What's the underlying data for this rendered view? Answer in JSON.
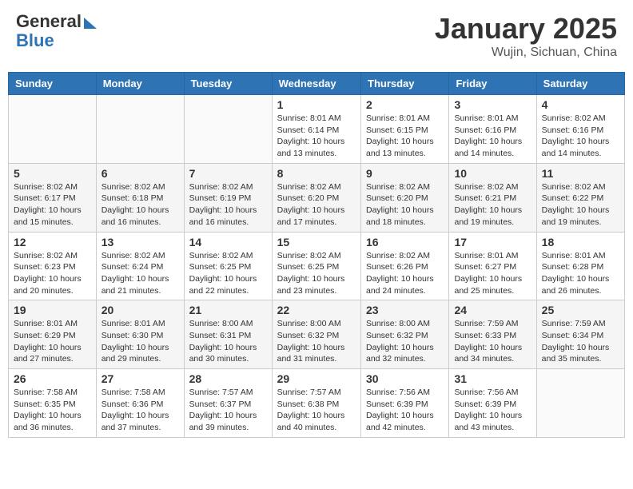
{
  "header": {
    "logo_general": "General",
    "logo_blue": "Blue",
    "month_title": "January 2025",
    "location": "Wujin, Sichuan, China"
  },
  "weekdays": [
    "Sunday",
    "Monday",
    "Tuesday",
    "Wednesday",
    "Thursday",
    "Friday",
    "Saturday"
  ],
  "weeks": [
    [
      {
        "day": "",
        "detail": ""
      },
      {
        "day": "",
        "detail": ""
      },
      {
        "day": "",
        "detail": ""
      },
      {
        "day": "1",
        "detail": "Sunrise: 8:01 AM\nSunset: 6:14 PM\nDaylight: 10 hours\nand 13 minutes."
      },
      {
        "day": "2",
        "detail": "Sunrise: 8:01 AM\nSunset: 6:15 PM\nDaylight: 10 hours\nand 13 minutes."
      },
      {
        "day": "3",
        "detail": "Sunrise: 8:01 AM\nSunset: 6:16 PM\nDaylight: 10 hours\nand 14 minutes."
      },
      {
        "day": "4",
        "detail": "Sunrise: 8:02 AM\nSunset: 6:16 PM\nDaylight: 10 hours\nand 14 minutes."
      }
    ],
    [
      {
        "day": "5",
        "detail": "Sunrise: 8:02 AM\nSunset: 6:17 PM\nDaylight: 10 hours\nand 15 minutes."
      },
      {
        "day": "6",
        "detail": "Sunrise: 8:02 AM\nSunset: 6:18 PM\nDaylight: 10 hours\nand 16 minutes."
      },
      {
        "day": "7",
        "detail": "Sunrise: 8:02 AM\nSunset: 6:19 PM\nDaylight: 10 hours\nand 16 minutes."
      },
      {
        "day": "8",
        "detail": "Sunrise: 8:02 AM\nSunset: 6:20 PM\nDaylight: 10 hours\nand 17 minutes."
      },
      {
        "day": "9",
        "detail": "Sunrise: 8:02 AM\nSunset: 6:20 PM\nDaylight: 10 hours\nand 18 minutes."
      },
      {
        "day": "10",
        "detail": "Sunrise: 8:02 AM\nSunset: 6:21 PM\nDaylight: 10 hours\nand 19 minutes."
      },
      {
        "day": "11",
        "detail": "Sunrise: 8:02 AM\nSunset: 6:22 PM\nDaylight: 10 hours\nand 19 minutes."
      }
    ],
    [
      {
        "day": "12",
        "detail": "Sunrise: 8:02 AM\nSunset: 6:23 PM\nDaylight: 10 hours\nand 20 minutes."
      },
      {
        "day": "13",
        "detail": "Sunrise: 8:02 AM\nSunset: 6:24 PM\nDaylight: 10 hours\nand 21 minutes."
      },
      {
        "day": "14",
        "detail": "Sunrise: 8:02 AM\nSunset: 6:25 PM\nDaylight: 10 hours\nand 22 minutes."
      },
      {
        "day": "15",
        "detail": "Sunrise: 8:02 AM\nSunset: 6:25 PM\nDaylight: 10 hours\nand 23 minutes."
      },
      {
        "day": "16",
        "detail": "Sunrise: 8:02 AM\nSunset: 6:26 PM\nDaylight: 10 hours\nand 24 minutes."
      },
      {
        "day": "17",
        "detail": "Sunrise: 8:01 AM\nSunset: 6:27 PM\nDaylight: 10 hours\nand 25 minutes."
      },
      {
        "day": "18",
        "detail": "Sunrise: 8:01 AM\nSunset: 6:28 PM\nDaylight: 10 hours\nand 26 minutes."
      }
    ],
    [
      {
        "day": "19",
        "detail": "Sunrise: 8:01 AM\nSunset: 6:29 PM\nDaylight: 10 hours\nand 27 minutes."
      },
      {
        "day": "20",
        "detail": "Sunrise: 8:01 AM\nSunset: 6:30 PM\nDaylight: 10 hours\nand 29 minutes."
      },
      {
        "day": "21",
        "detail": "Sunrise: 8:00 AM\nSunset: 6:31 PM\nDaylight: 10 hours\nand 30 minutes."
      },
      {
        "day": "22",
        "detail": "Sunrise: 8:00 AM\nSunset: 6:32 PM\nDaylight: 10 hours\nand 31 minutes."
      },
      {
        "day": "23",
        "detail": "Sunrise: 8:00 AM\nSunset: 6:32 PM\nDaylight: 10 hours\nand 32 minutes."
      },
      {
        "day": "24",
        "detail": "Sunrise: 7:59 AM\nSunset: 6:33 PM\nDaylight: 10 hours\nand 34 minutes."
      },
      {
        "day": "25",
        "detail": "Sunrise: 7:59 AM\nSunset: 6:34 PM\nDaylight: 10 hours\nand 35 minutes."
      }
    ],
    [
      {
        "day": "26",
        "detail": "Sunrise: 7:58 AM\nSunset: 6:35 PM\nDaylight: 10 hours\nand 36 minutes."
      },
      {
        "day": "27",
        "detail": "Sunrise: 7:58 AM\nSunset: 6:36 PM\nDaylight: 10 hours\nand 37 minutes."
      },
      {
        "day": "28",
        "detail": "Sunrise: 7:57 AM\nSunset: 6:37 PM\nDaylight: 10 hours\nand 39 minutes."
      },
      {
        "day": "29",
        "detail": "Sunrise: 7:57 AM\nSunset: 6:38 PM\nDaylight: 10 hours\nand 40 minutes."
      },
      {
        "day": "30",
        "detail": "Sunrise: 7:56 AM\nSunset: 6:39 PM\nDaylight: 10 hours\nand 42 minutes."
      },
      {
        "day": "31",
        "detail": "Sunrise: 7:56 AM\nSunset: 6:39 PM\nDaylight: 10 hours\nand 43 minutes."
      },
      {
        "day": "",
        "detail": ""
      }
    ]
  ]
}
